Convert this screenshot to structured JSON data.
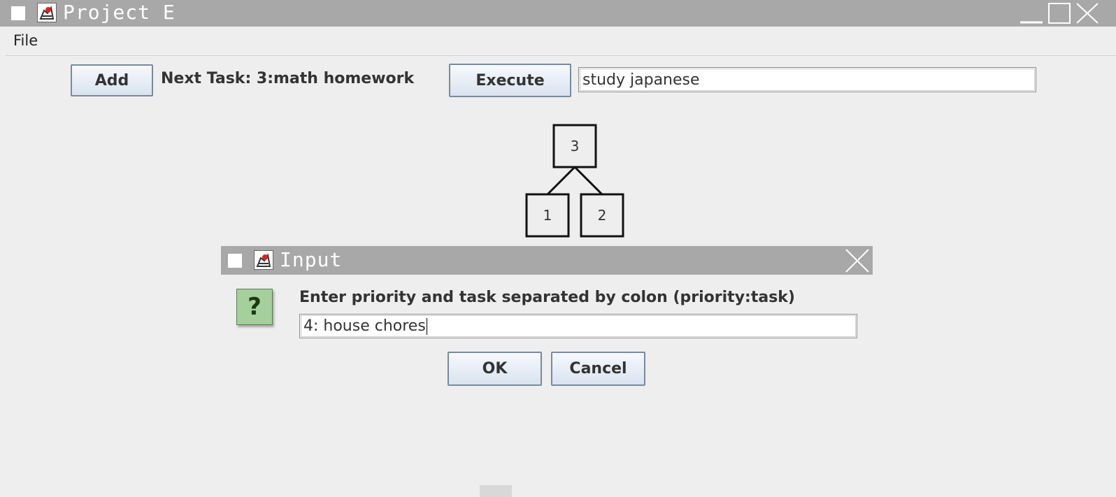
{
  "window": {
    "title": "Project E",
    "icon": "java-duke-icon",
    "controls": [
      "minimize-icon",
      "maximize-icon",
      "close-icon"
    ]
  },
  "menubar": {
    "items": [
      "File"
    ]
  },
  "toolbar": {
    "add_label": "Add",
    "next_task_label": "Next Task: 3:math homework",
    "execute_label": "Execute",
    "task_field_value": "study japanese"
  },
  "heap_tree": {
    "nodes": [
      {
        "id": "root",
        "label": "3"
      },
      {
        "id": "left",
        "label": "1"
      },
      {
        "id": "right",
        "label": "2"
      }
    ],
    "edges": [
      [
        "root",
        "left"
      ],
      [
        "root",
        "right"
      ]
    ]
  },
  "dialog": {
    "title": "Input",
    "icon": "question-icon",
    "icon_glyph": "?",
    "message": "Enter priority and task separated by colon (priority:task)",
    "input_value": "4: house chores",
    "ok_label": "OK",
    "cancel_label": "Cancel"
  },
  "colors": {
    "titlebar": "#a8a8a8",
    "background": "#eeeeee",
    "question_icon_bg": "#a5cf9b"
  }
}
